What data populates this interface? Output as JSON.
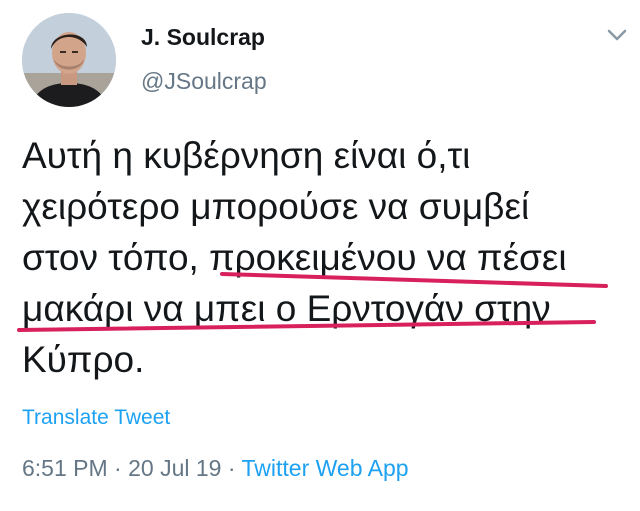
{
  "tweet": {
    "author": {
      "display_name": "J. Soulcrap",
      "handle": "@JSoulcrap"
    },
    "text_lines": [
      "Αυτή η κυβέρνηση είναι ό,τι",
      "χειρότερο μπορούσε να συμβεί",
      "στον τόπο, προκειμένου να πέσει",
      "μακάρι να μπει ο Ερντογάν στην",
      "Κύπρο."
    ],
    "translate_label": "Translate Tweet",
    "time": "6:51 PM",
    "separator": " · ",
    "date": "20 Jul 19",
    "source": "Twitter Web App"
  },
  "icons": {
    "menu": "chevron-down-icon"
  },
  "colors": {
    "link": "#1da1f2",
    "secondary_text": "#657786",
    "primary_text": "#14171a",
    "highlight_underline": "#d8215c"
  }
}
